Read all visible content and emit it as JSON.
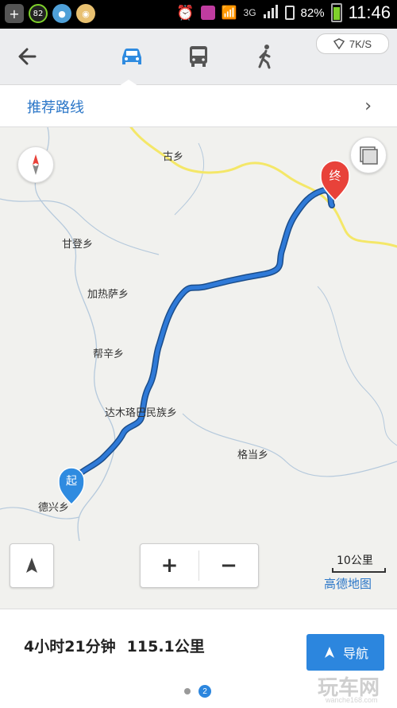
{
  "status_bar": {
    "badge": "82",
    "network": "3G",
    "battery": "82%",
    "battery_level": 0.82,
    "time": "11:46"
  },
  "top_bar": {
    "modes": [
      "car",
      "bus",
      "walk"
    ],
    "active_mode": "car",
    "speed": "7K/S"
  },
  "route_header": {
    "label": "推荐路线"
  },
  "map": {
    "places": {
      "gu": "古乡",
      "gandeng": "甘登乡",
      "jiaresa": "加热萨乡",
      "bangxin": "帮辛乡",
      "damuluoba": "达木珞巴民族乡",
      "gedang": "格当乡",
      "dexing": "德兴乡"
    },
    "start_marker": "起",
    "end_marker": "终",
    "scale": "10公里",
    "logo": "高德地图",
    "route_color": "#2f7ad8",
    "road_color": "#f4e768"
  },
  "controls": {
    "zoom_in": "+",
    "zoom_out": "−"
  },
  "summary": {
    "time": "4小时21分钟",
    "distance": "115.1公里",
    "nav_label": "导航",
    "page_indicator": "2"
  },
  "watermark": {
    "main": "玩车网",
    "sub": "wanche168.com"
  }
}
